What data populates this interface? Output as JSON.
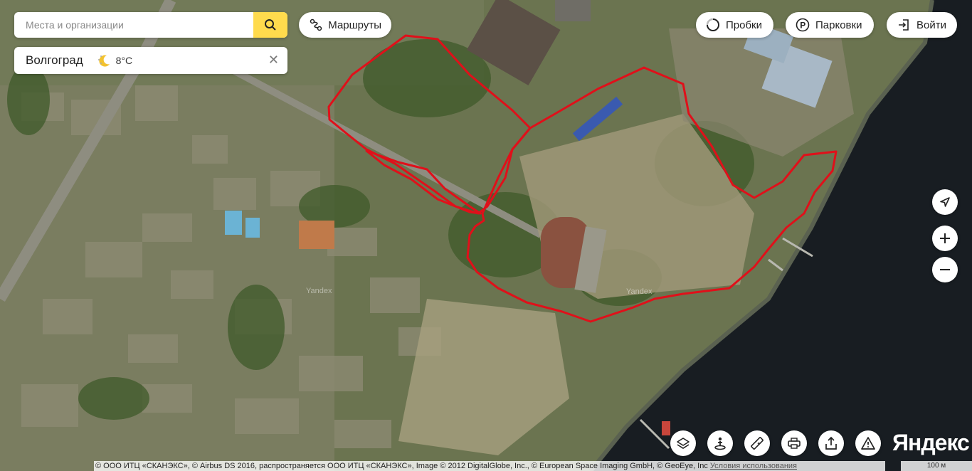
{
  "search": {
    "placeholder": "Места и организации"
  },
  "toolbar": {
    "routes_label": "Маршруты",
    "traffic_label": "Пробки",
    "parking_label": "Парковки",
    "login_label": "Войти"
  },
  "city_card": {
    "name": "Волгоград",
    "temperature": "8°C",
    "weather_icon": "night-cloud-icon"
  },
  "map": {
    "type": "satellite",
    "route_color": "#e0101a",
    "watermarks": [
      "Yandex",
      "Yandex"
    ]
  },
  "controls": {
    "locate_icon": "navigation-arrow-icon",
    "zoom_in_icon": "plus-icon",
    "zoom_out_icon": "minus-icon"
  },
  "bottom_tools": [
    "layers-icon",
    "panorama-person-icon",
    "ruler-icon",
    "print-icon",
    "share-icon",
    "warning-icon"
  ],
  "logo": "Яндекс",
  "copyright": "© ООО ИТЦ «СКАНЭКС», © Airbus DS 2016, распространяется ООО ИТЦ «СКАНЭКС», Image © 2012 DigitalGlobe, Inc., © European Space Imaging GmbH, © GeoEye, Inc",
  "terms_link": "Условия использования",
  "scale_label": "100 м"
}
